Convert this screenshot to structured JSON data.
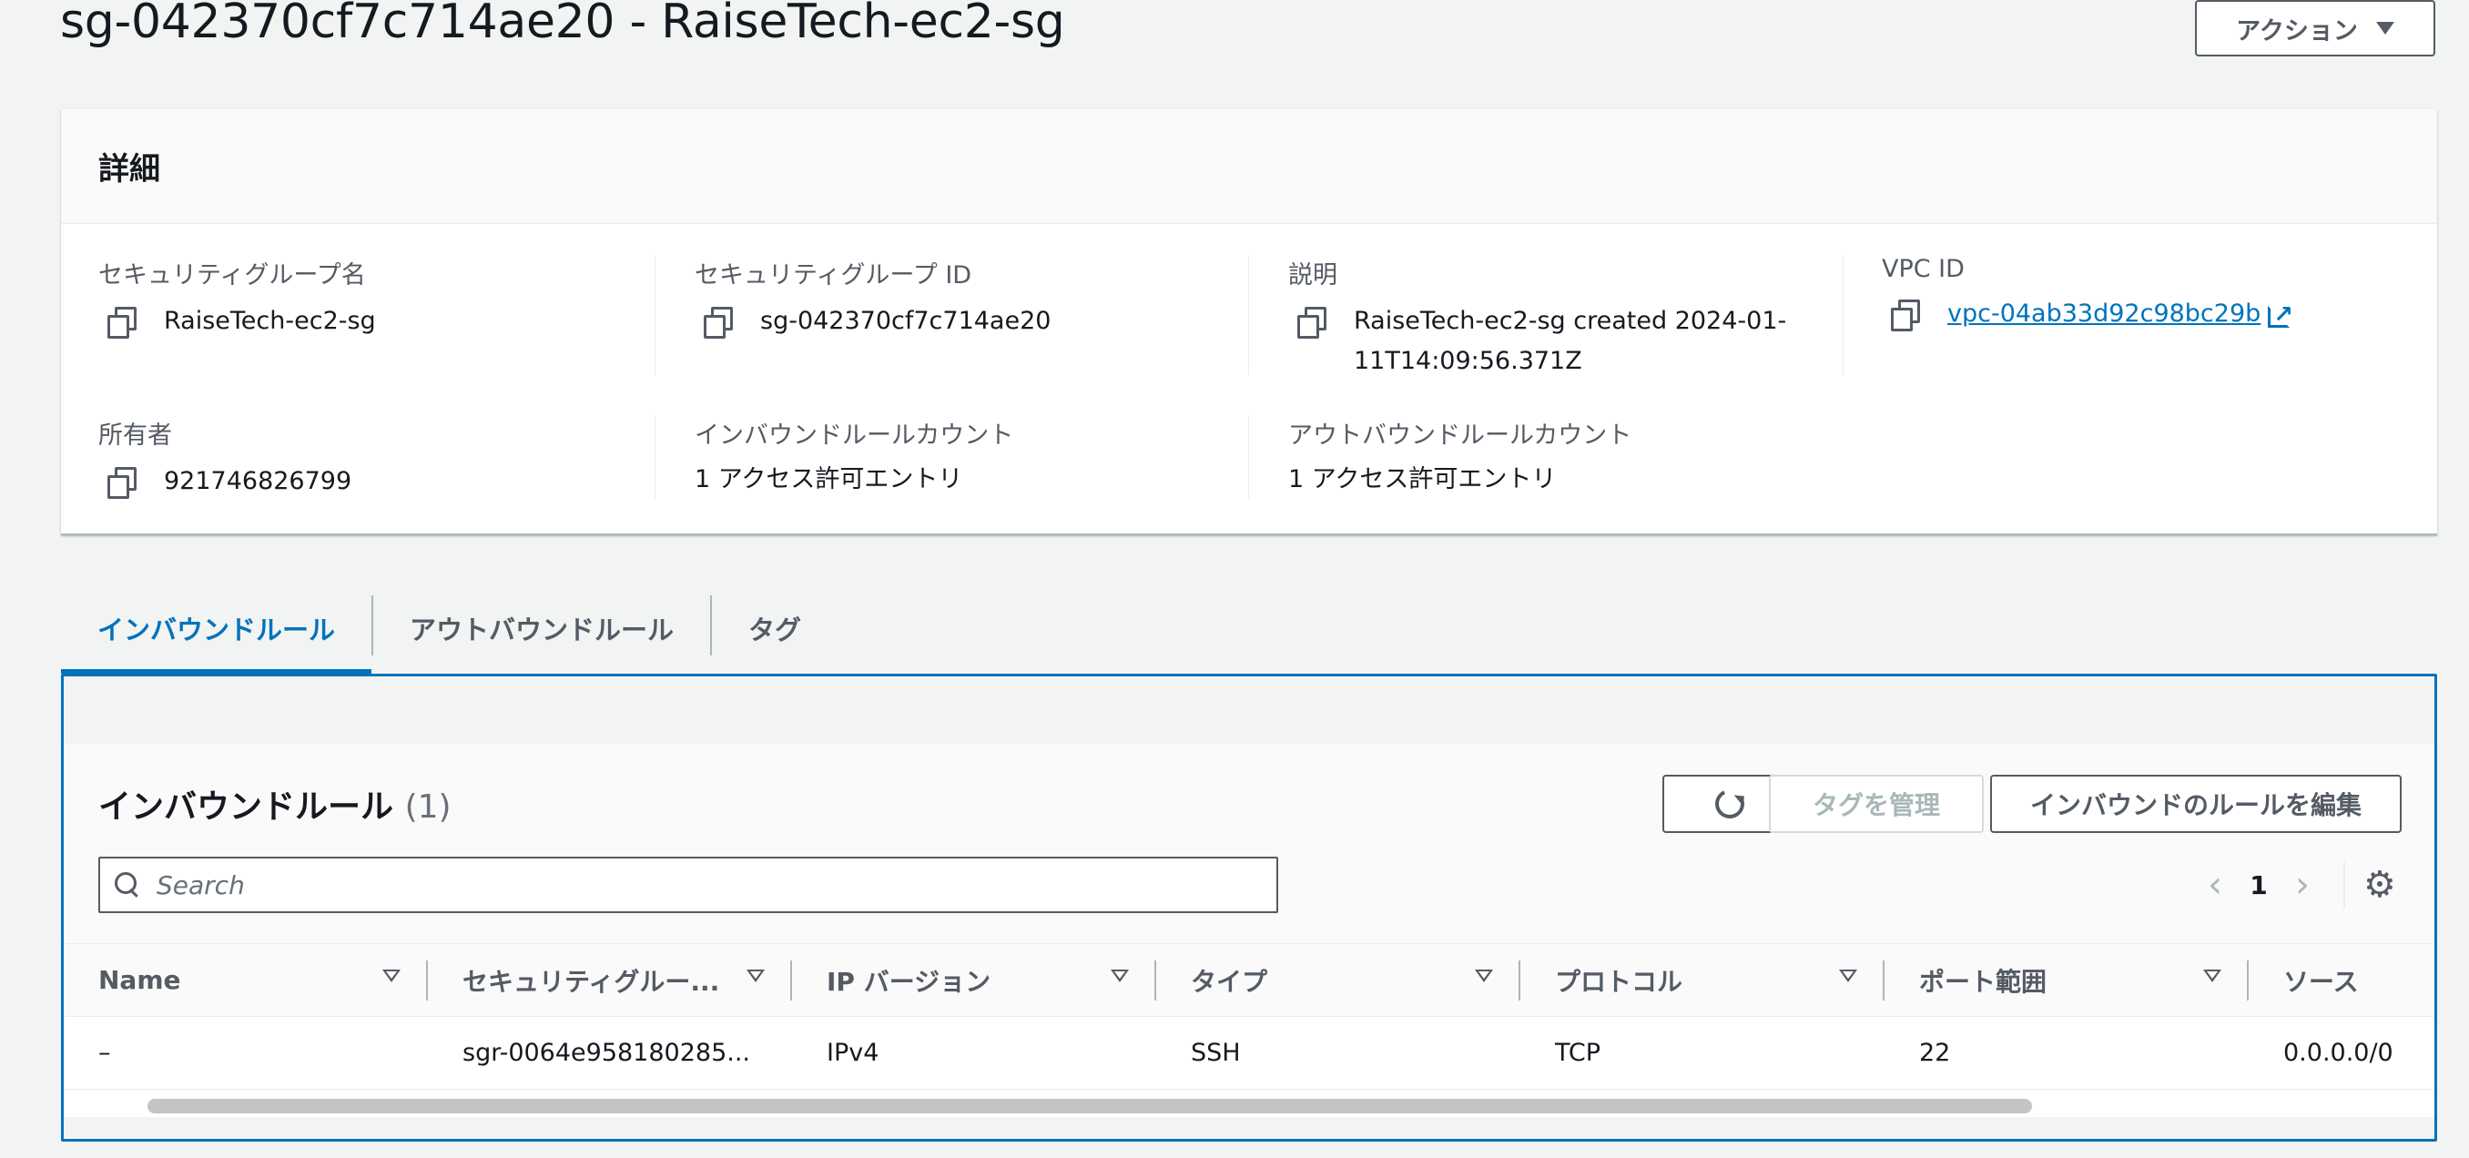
{
  "header": {
    "title": "sg-042370cf7c714ae20 - RaiseTech-ec2-sg",
    "actions_label": "アクション"
  },
  "details": {
    "heading": "詳細",
    "sg_name_label": "セキュリティグループ名",
    "sg_name_value": "RaiseTech-ec2-sg",
    "sg_id_label": "セキュリティグループ ID",
    "sg_id_value": "sg-042370cf7c714ae20",
    "description_label": "説明",
    "description_value": "RaiseTech-ec2-sg created 2024-01-11T14:09:56.371Z",
    "vpc_id_label": "VPC ID",
    "vpc_id_value": "vpc-04ab33d92c98bc29b",
    "owner_label": "所有者",
    "owner_value": "921746826799",
    "inbound_count_label": "インバウンドルールカウント",
    "inbound_count_value": "1 アクセス許可エントリ",
    "outbound_count_label": "アウトバウンドルールカウント",
    "outbound_count_value": "1 アクセス許可エントリ"
  },
  "tabs": [
    {
      "label": "インバウンドルール",
      "active": true
    },
    {
      "label": "アウトバウンドルール",
      "active": false
    },
    {
      "label": "タグ",
      "active": false
    }
  ],
  "rules": {
    "title": "インバウンドルール",
    "count": "(1)",
    "manage_tags_label": "タグを管理",
    "edit_label": "インバウンドのルールを編集",
    "search_placeholder": "Search",
    "page": "1",
    "columns": [
      "Name",
      "セキュリティグルー...",
      "IP バージョン",
      "タイプ",
      "プロトコル",
      "ポート範囲",
      "ソース"
    ],
    "rows": [
      [
        "–",
        "sgr-0064e958180285...",
        "IPv4",
        "SSH",
        "TCP",
        "22",
        "0.0.0.0/0"
      ]
    ]
  },
  "colors": {
    "accent": "#0073bb",
    "text": "#16191f",
    "muted": "#545b64",
    "background": "#f2f3f3"
  }
}
